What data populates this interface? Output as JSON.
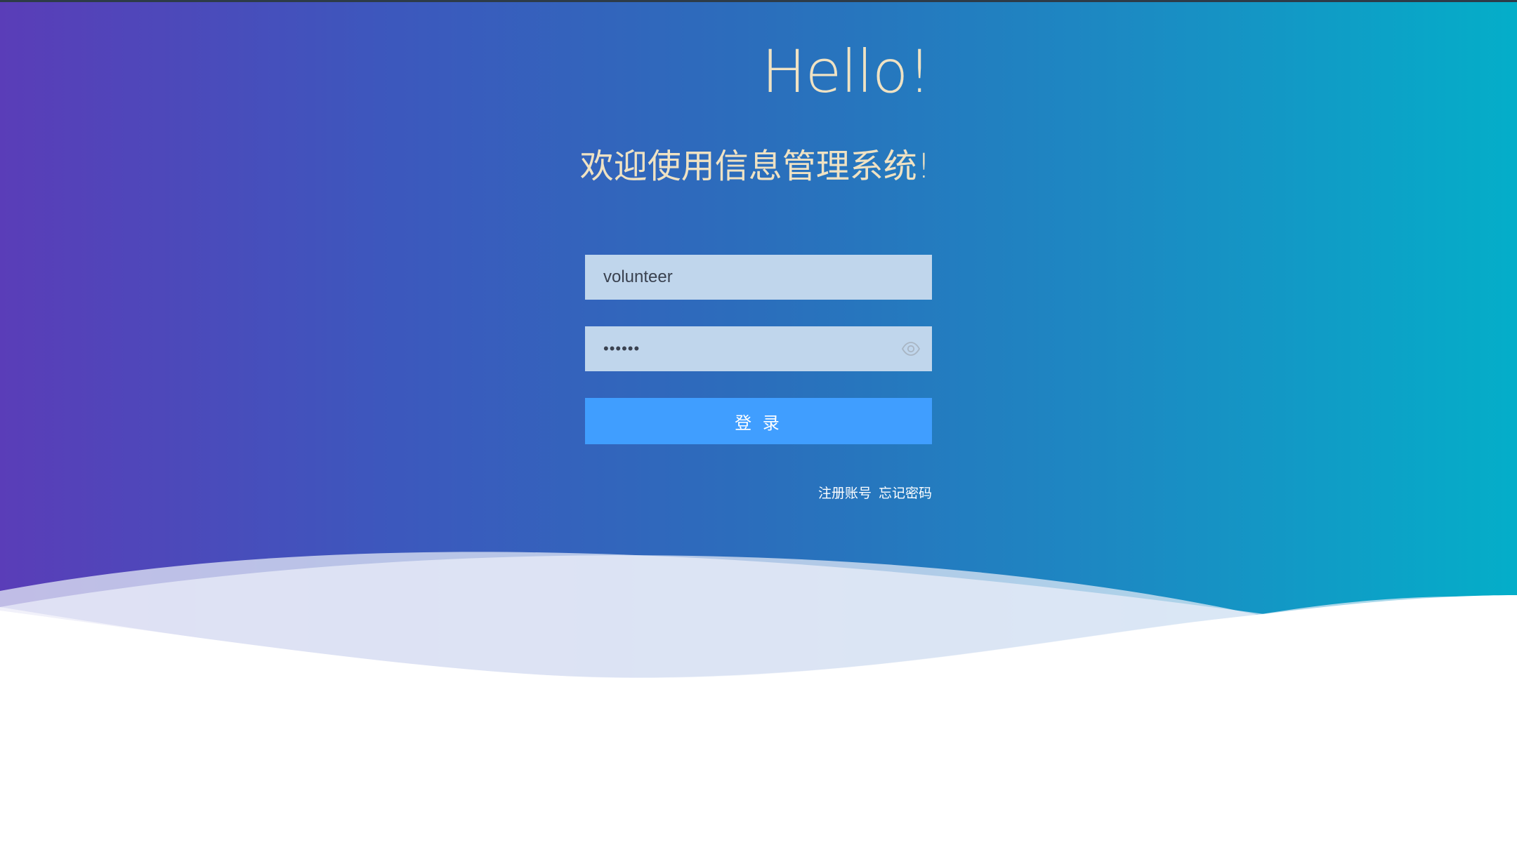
{
  "header": {
    "greeting": "Hello!",
    "subtitle": "欢迎使用信息管理系统!"
  },
  "form": {
    "username": {
      "value": "volunteer",
      "placeholder": ""
    },
    "password": {
      "value": "••••••",
      "placeholder": ""
    },
    "login_label": "登 录",
    "password_toggle_icon": "eye-icon"
  },
  "links": {
    "register": "注册账号",
    "forgot": "忘记密码"
  },
  "colors": {
    "gradient_left": "#5a3db8",
    "gradient_right": "#04aec9",
    "title_text": "#efe2c3",
    "input_bg": "#c0d6ec",
    "button_bg": "#409eff",
    "button_text": "#ffffff"
  }
}
